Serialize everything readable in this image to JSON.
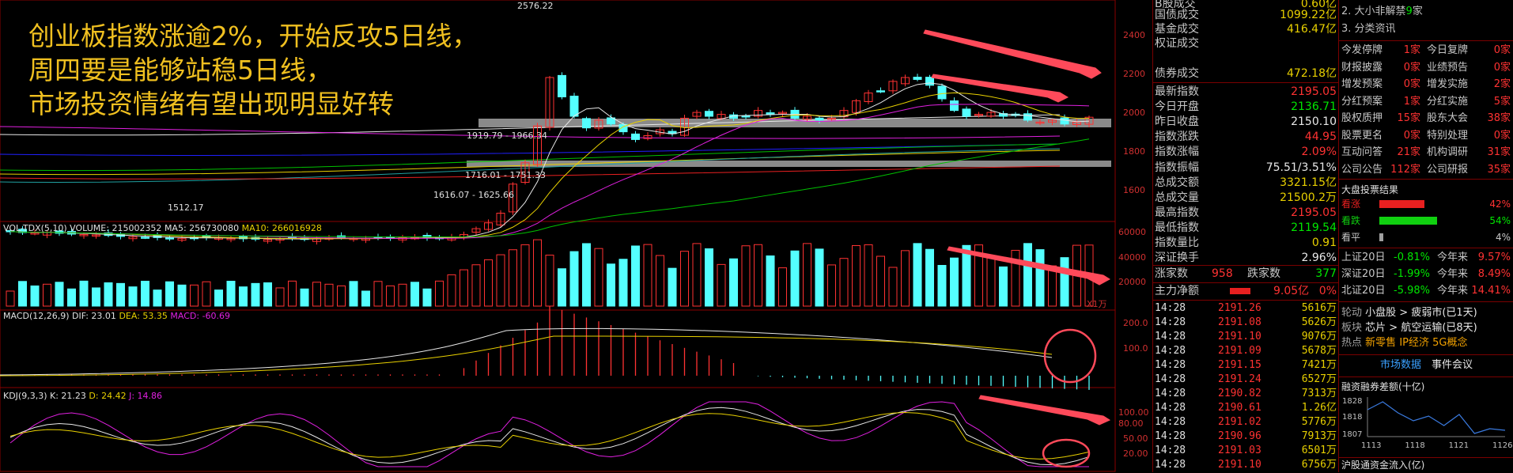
{
  "overlay_text": [
    "创业板指数涨逾2%，开始反攻5日线，",
    "周四要是能够站稳5日线，",
    "市场投资情绪有望出现明显好转"
  ],
  "kline": {
    "high_label": "2576.22",
    "low_label": "1512.17",
    "annotations": [
      "1919.79 - 1966.34",
      "1716.01 - 1751.33",
      "1616.07 - 1625.66"
    ],
    "yaxis": [
      "2400",
      "2200",
      "2000",
      "1800",
      "1600"
    ]
  },
  "vol": {
    "title_prefix": "VOL-TDX(5,10) VOLUME: 215002352",
    "ma5": "MA5: 256730080",
    "ma10": "MA10: 266016928",
    "yaxis": [
      "60000",
      "40000",
      "20000"
    ],
    "unit": "X1万"
  },
  "macd": {
    "title": "MACD(12,26,9)",
    "dif": "DIF: 23.01",
    "dea": "DEA: 53.35",
    "macd": "MACD: -60.69",
    "yaxis": [
      "200.0",
      "100.0"
    ]
  },
  "kdj": {
    "title": "KDJ(9,3,3)",
    "k": "K: 21.23",
    "d": "D: 24.42",
    "j": "J: 14.86",
    "yaxis": [
      "100.00",
      "80.00",
      "50.00",
      "20.00"
    ]
  },
  "quote": {
    "rows": [
      {
        "label": "B股成交",
        "value": "0.60亿",
        "color": "#e8d000"
      },
      {
        "label": "国债成交",
        "value": "1099.22亿",
        "color": "#e8d000"
      },
      {
        "label": "基金成交",
        "value": "416.47亿",
        "color": "#e8d000"
      },
      {
        "label": "权证成交",
        "value": "",
        "color": "#e8d000"
      },
      {
        "label": "债券成交",
        "value": "472.18亿",
        "color": "#e8d000"
      }
    ],
    "stats": [
      {
        "label": "最新指数",
        "value": "2195.05",
        "color": "#ff3232"
      },
      {
        "label": "今日开盘",
        "value": "2136.71",
        "color": "#00e600"
      },
      {
        "label": "昨日收盘",
        "value": "2150.10",
        "color": "#e8e8e8"
      },
      {
        "label": "指数涨跌",
        "value": "44.95",
        "color": "#ff3232"
      },
      {
        "label": "指数涨幅",
        "value": "2.09%",
        "color": "#ff3232"
      },
      {
        "label": "指数振幅",
        "value": "75.51/3.51%",
        "color": "#e8e8e8"
      },
      {
        "label": "总成交额",
        "value": "3321.15亿",
        "color": "#e8d000"
      },
      {
        "label": "总成交量",
        "value": "21500.2万",
        "color": "#e8d000"
      },
      {
        "label": "最高指数",
        "value": "2195.05",
        "color": "#ff3232"
      },
      {
        "label": "最低指数",
        "value": "2119.54",
        "color": "#00e600"
      },
      {
        "label": "指数量比",
        "value": "0.91",
        "color": "#e8d000"
      },
      {
        "label": "深证换手",
        "value": "2.96%",
        "color": "#e8e8e8"
      }
    ],
    "up_label": "涨家数",
    "up_value": "958",
    "down_label": "跌家数",
    "down_value": "377",
    "main_label": "主力净额",
    "main_value": "9.05亿",
    "main_pct": "0%",
    "ticks": [
      {
        "time": "14:28",
        "price": "2191.26",
        "vol": "5616万"
      },
      {
        "time": "14:28",
        "price": "2191.08",
        "vol": "5626万"
      },
      {
        "time": "14:28",
        "price": "2191.10",
        "vol": "9076万"
      },
      {
        "time": "14:28",
        "price": "2191.09",
        "vol": "5678万"
      },
      {
        "time": "14:28",
        "price": "2191.15",
        "vol": "7421万"
      },
      {
        "time": "14:28",
        "price": "2191.24",
        "vol": "6527万"
      },
      {
        "time": "14:28",
        "price": "2190.82",
        "vol": "7313万"
      },
      {
        "time": "14:28",
        "price": "2190.61",
        "vol": "1.26亿"
      },
      {
        "time": "14:28",
        "price": "2191.02",
        "vol": "5776万"
      },
      {
        "time": "14:28",
        "price": "2190.96",
        "vol": "7913万"
      },
      {
        "time": "14:28",
        "price": "2191.03",
        "vol": "6501万"
      },
      {
        "time": "14:28",
        "price": "2191.10",
        "vol": "6756万"
      }
    ]
  },
  "info": {
    "top_items": [
      {
        "text": "2. 大小非解禁",
        "num": "9",
        "unit": "家"
      },
      {
        "text": "3. 分类资讯",
        "num": "",
        "unit": ""
      }
    ],
    "grid": [
      [
        "今发停牌",
        "1家",
        "今日复牌",
        "0家"
      ],
      [
        "财报披露",
        "0家",
        "业绩预告",
        "0家"
      ],
      [
        "增发预案",
        "0家",
        "增发实施",
        "2家"
      ],
      [
        "分红预案",
        "1家",
        "分红实施",
        "5家"
      ],
      [
        "股权质押",
        "15家",
        "股东大会",
        "38家"
      ],
      [
        "股票更名",
        "0家",
        "特别处理",
        "0家"
      ],
      [
        "互动问答",
        "21家",
        "机构调研",
        "31家"
      ],
      [
        "公司公告",
        "112家",
        "公司研报",
        "35家"
      ]
    ],
    "vote_title": "大盘投票结果",
    "votes": [
      {
        "label": "看涨",
        "pct": "42%",
        "fill": 0.42,
        "color": "#e82020"
      },
      {
        "label": "看跌",
        "pct": "54%",
        "fill": 0.54,
        "color": "#10d010"
      },
      {
        "label": "看平",
        "pct": "4%",
        "fill": 0.04,
        "color": "#a0a0a0"
      }
    ],
    "indices": [
      {
        "name": "上证20日",
        "val": "-0.81%",
        "ytd_label": "今年来",
        "ytd": "9.57%"
      },
      {
        "name": "深证20日",
        "val": "-1.99%",
        "ytd_label": "今年来",
        "ytd": "8.49%"
      },
      {
        "name": "北证20日",
        "val": "-5.98%",
        "ytd_label": "今年来",
        "ytd": "14.41%"
      }
    ],
    "rotation": [
      {
        "label": "轮动",
        "text": "小盘股 > 疲弱市(已1天)"
      },
      {
        "label": "板块",
        "text": "芯片 > 航空运输(已8天)"
      }
    ],
    "hot_label": "热点",
    "hot_items": [
      "新零售",
      "IP经济",
      "5G概念"
    ],
    "tab_market": "市场数据",
    "tab_events": "事件会议",
    "margin_title": "融资融券差额(十亿)",
    "margin_chart": {
      "type": "line",
      "x": [
        "1113",
        "1118",
        "1121",
        "1126"
      ],
      "yticks": [
        "1828",
        "1818",
        "1807"
      ],
      "values": [
        1822,
        1827,
        1820,
        1815,
        1818,
        1812,
        1819,
        1807,
        1810,
        1809
      ],
      "ylim": [
        1805,
        1830
      ]
    },
    "northbound_title": "沪股通资金流入(亿)"
  }
}
